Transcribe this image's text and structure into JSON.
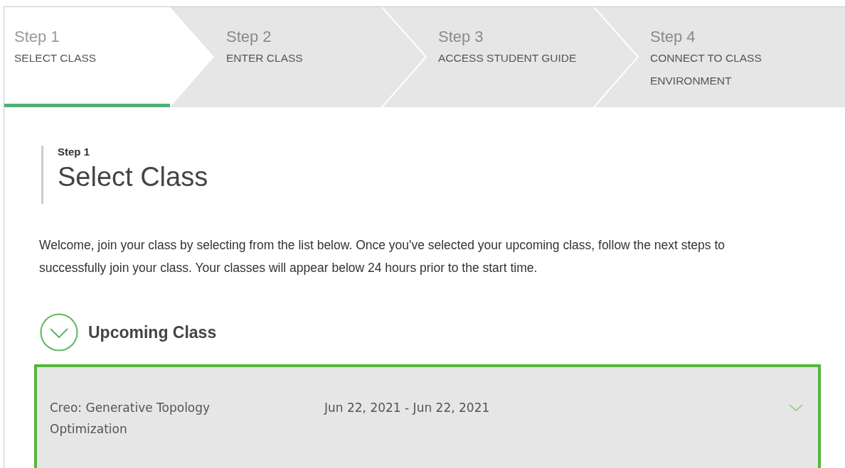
{
  "steps": [
    {
      "number": "Step 1",
      "title": "SELECT CLASS",
      "selected": true
    },
    {
      "number": "Step 2",
      "title": "ENTER CLASS",
      "selected": false
    },
    {
      "number": "Step 3",
      "title": "ACCESS STUDENT GUIDE",
      "selected": false
    },
    {
      "number": "Step 4",
      "title": "CONNECT TO CLASS ENVIRONMENT",
      "selected": false
    }
  ],
  "heading": {
    "step": "Step 1",
    "title": "Select Class"
  },
  "intro": "Welcome, join your class by selecting from the list below. Once you've selected your upcoming class, follow the next steps to successfully join your class. Your classes will appear below 24 hours prior to the start time.",
  "section": {
    "title": "Upcoming Class",
    "expanded": true
  },
  "classes": [
    {
      "name": "Creo: Generative Topology Optimization",
      "dates": "Jun 22, 2021 - Jun 22, 2021",
      "selected": true
    }
  ]
}
